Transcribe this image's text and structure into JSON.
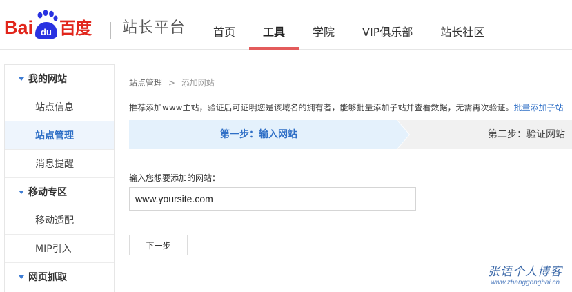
{
  "header": {
    "logo": {
      "bai": "Bai",
      "du": "du",
      "cn": "百度"
    },
    "site_title": "站长平台",
    "nav": [
      {
        "label": "首页",
        "active": false
      },
      {
        "label": "工具",
        "active": true
      },
      {
        "label": "学院",
        "active": false
      },
      {
        "label": "VIP俱乐部",
        "active": false
      },
      {
        "label": "站长社区",
        "active": false
      }
    ]
  },
  "sidebar": {
    "groups": [
      {
        "title": "我的网站",
        "items": [
          {
            "label": "站点信息",
            "active": false
          },
          {
            "label": "站点管理",
            "active": true
          },
          {
            "label": "消息提醒",
            "active": false
          }
        ]
      },
      {
        "title": "移动专区",
        "items": [
          {
            "label": "移动适配",
            "active": false
          },
          {
            "label": "MIP引入",
            "active": false
          }
        ]
      },
      {
        "title": "网页抓取",
        "items": []
      }
    ]
  },
  "main": {
    "breadcrumb": {
      "parent": "站点管理",
      "separator": ">",
      "current": "添加网站"
    },
    "notice": {
      "text": "推荐添加www主站，验证后可证明您是该域名的拥有者，能够批量添加子站并查看数据，无需再次验证。",
      "link": "批量添加子站"
    },
    "steps": {
      "step1": "第一步：输入网站",
      "step2": "第二步：验证网站"
    },
    "input_label": "输入您想要添加的网站：",
    "site_input_value": "www.yoursite.com",
    "next_button": "下一步"
  },
  "watermark": {
    "cn": "张语个人博客",
    "url": "www.zhanggonghai.cn"
  },
  "colors": {
    "brand_red": "#e1251b",
    "nav_underline": "#e35b5b",
    "link_blue": "#2f6fc6",
    "step_active_bg": "#e4f1fc"
  }
}
